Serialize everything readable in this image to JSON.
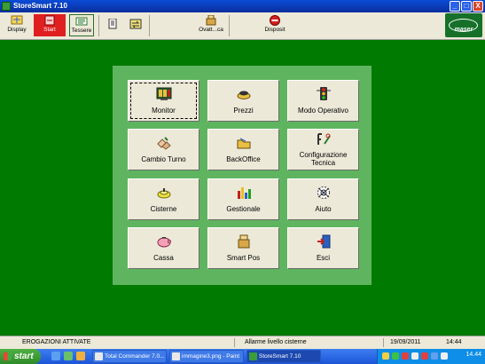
{
  "window": {
    "title": "StoreSmart 7.10",
    "controls": [
      "_",
      "□",
      "X"
    ]
  },
  "toolbar": {
    "buttons": [
      {
        "label": "Display",
        "icon": "display-icon"
      },
      {
        "label": "Start",
        "icon": "start-icon"
      },
      {
        "label": "Tessere",
        "icon": "tessere-icon"
      },
      {
        "label": "",
        "icon": "report-icon"
      },
      {
        "label": "",
        "icon": "transfer-icon"
      },
      {
        "label": "Ovatt...ca",
        "icon": "cash-register-icon"
      },
      {
        "label": "Disposit",
        "icon": "stop-icon"
      }
    ],
    "brand": "maser"
  },
  "menu": {
    "tiles": [
      {
        "label": "Monitor",
        "icon": "monitor-icon",
        "focused": true
      },
      {
        "label": "Prezzi",
        "icon": "prices-icon"
      },
      {
        "label": "Modo Operativo",
        "icon": "traffic-light-icon"
      },
      {
        "label": "Cambio Turno",
        "icon": "shift-change-icon"
      },
      {
        "label": "BackOffice",
        "icon": "folder-icon"
      },
      {
        "label": "Configurazione\nTecnica",
        "icon": "tools-icon"
      },
      {
        "label": "Cisterne",
        "icon": "tank-icon"
      },
      {
        "label": "Gestionale",
        "icon": "bar-chart-icon"
      },
      {
        "label": "Aiuto",
        "icon": "help-icon"
      },
      {
        "label": "Cassa",
        "icon": "piggy-bank-icon"
      },
      {
        "label": "Smart Pos",
        "icon": "smart-pos-icon"
      },
      {
        "label": "Esci",
        "icon": "exit-door-icon"
      }
    ]
  },
  "status": {
    "left": "EROGAZIONI ATTIVATE",
    "middle": "Allarme livello cisterne",
    "date": "19/09/2011",
    "time": "14:44"
  },
  "taskbar": {
    "start_label": "start",
    "tasks": [
      {
        "label": "Total Commander 7.0...",
        "active": false
      },
      {
        "label": "immagine3.png - Paint",
        "active": false
      },
      {
        "label": "StoreSmart 7.10",
        "active": true
      }
    ],
    "clock": "14.44"
  },
  "colors": {
    "workspace": "#007a00",
    "panel": "#5fb55f",
    "tile": "#ece9d8",
    "titlebar": "#0a4bd6"
  }
}
